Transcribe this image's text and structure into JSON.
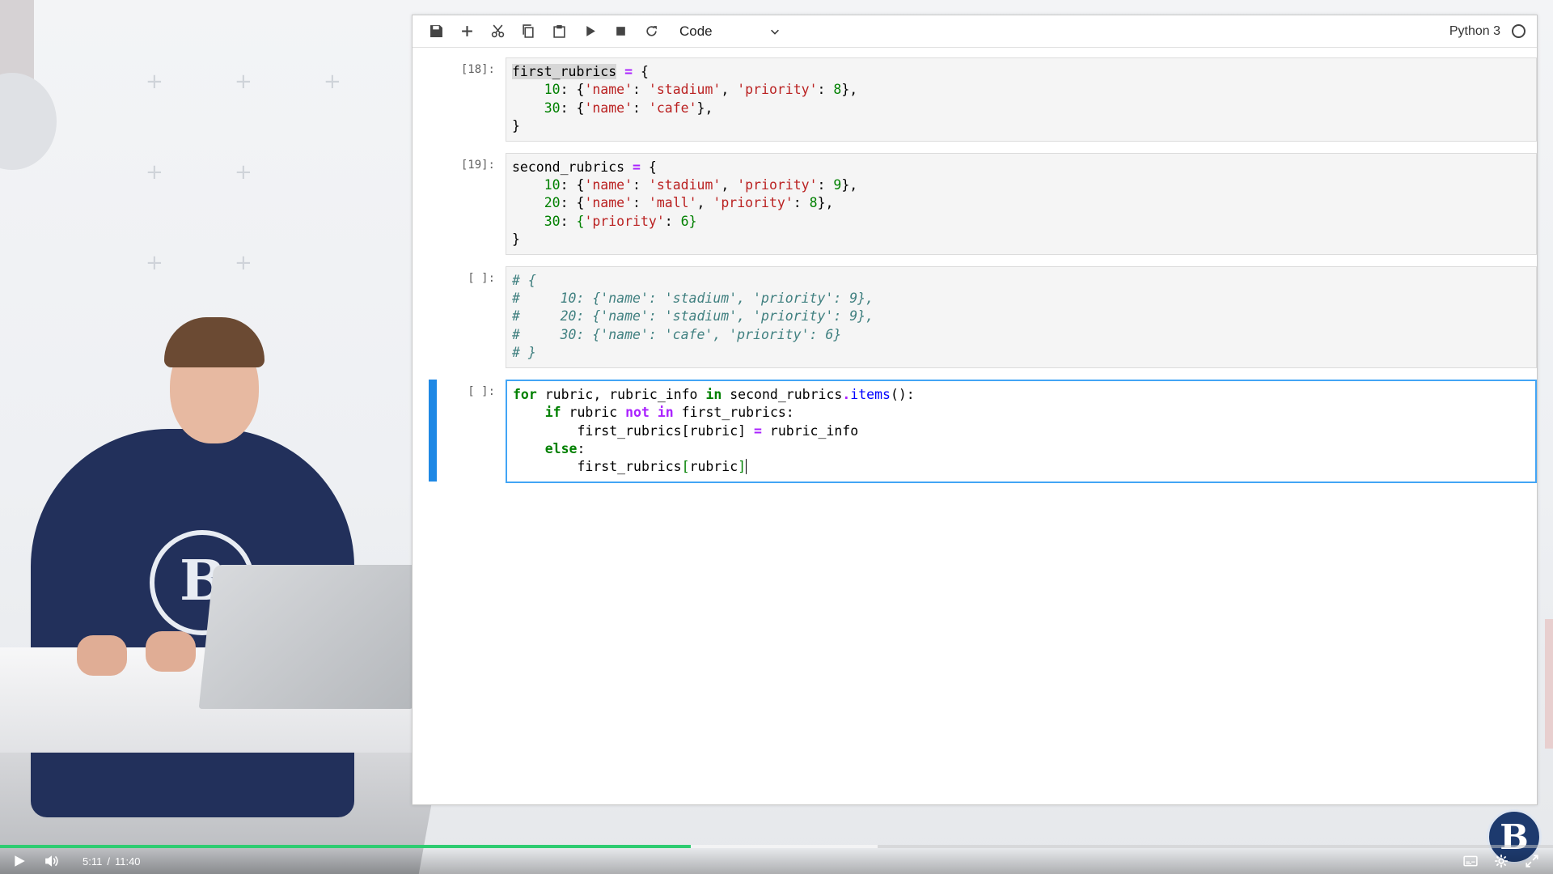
{
  "toolbar": {
    "cell_type": "Code",
    "kernel_name": "Python 3",
    "icons": [
      "save-icon",
      "plus-icon",
      "cut-icon",
      "copy-icon",
      "paste-icon",
      "run-icon",
      "stop-icon",
      "restart-icon",
      "chevron-down-icon",
      "kernel-status-icon"
    ]
  },
  "cells": [
    {
      "prompt": "[18]:"
    },
    {
      "prompt": "[19]:"
    },
    {
      "prompt": "[ ]:"
    },
    {
      "prompt": "[ ]:"
    }
  ],
  "player": {
    "current_time": "5:11",
    "separator": "/",
    "total_time": "11:40",
    "progress_fraction": 0.445,
    "buffered_fraction": 0.565,
    "icons": [
      "play-icon",
      "volume-icon",
      "subtitles-icon",
      "settings-icon",
      "fullscreen-icon"
    ]
  },
  "colors": {
    "accent_blue": "#1e88e5",
    "progress_green": "#2ecc71"
  }
}
